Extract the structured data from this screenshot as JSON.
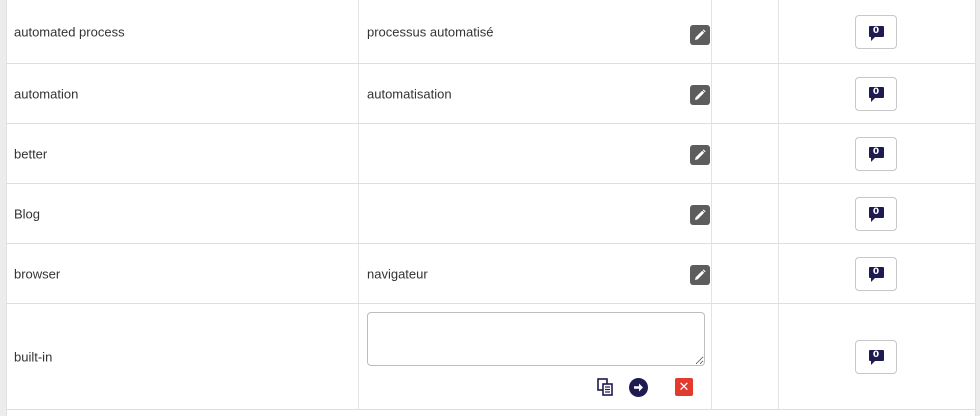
{
  "rows": [
    {
      "source": "automated process",
      "target": "processus automatisé",
      "comment_count": "0"
    },
    {
      "source": "automation",
      "target": "automatisation",
      "comment_count": "0"
    },
    {
      "source": "better",
      "target": "",
      "comment_count": "0"
    },
    {
      "source": "Blog",
      "target": "",
      "comment_count": "0"
    },
    {
      "source": "browser",
      "target": "navigateur",
      "comment_count": "0"
    },
    {
      "source": "built-in",
      "target": "",
      "comment_count": "0",
      "editing": true
    }
  ],
  "edit": {
    "input_value": "",
    "copy_icon": "copy-source-icon",
    "submit_icon": "arrow-right-circle-icon",
    "cancel_icon": "close-icon",
    "cancel_glyph": "✕"
  },
  "colors": {
    "edit_icon_bg": "#5d5d5d",
    "comment_bubble": "#1d1b4f",
    "cancel_red": "#e23a2c"
  }
}
